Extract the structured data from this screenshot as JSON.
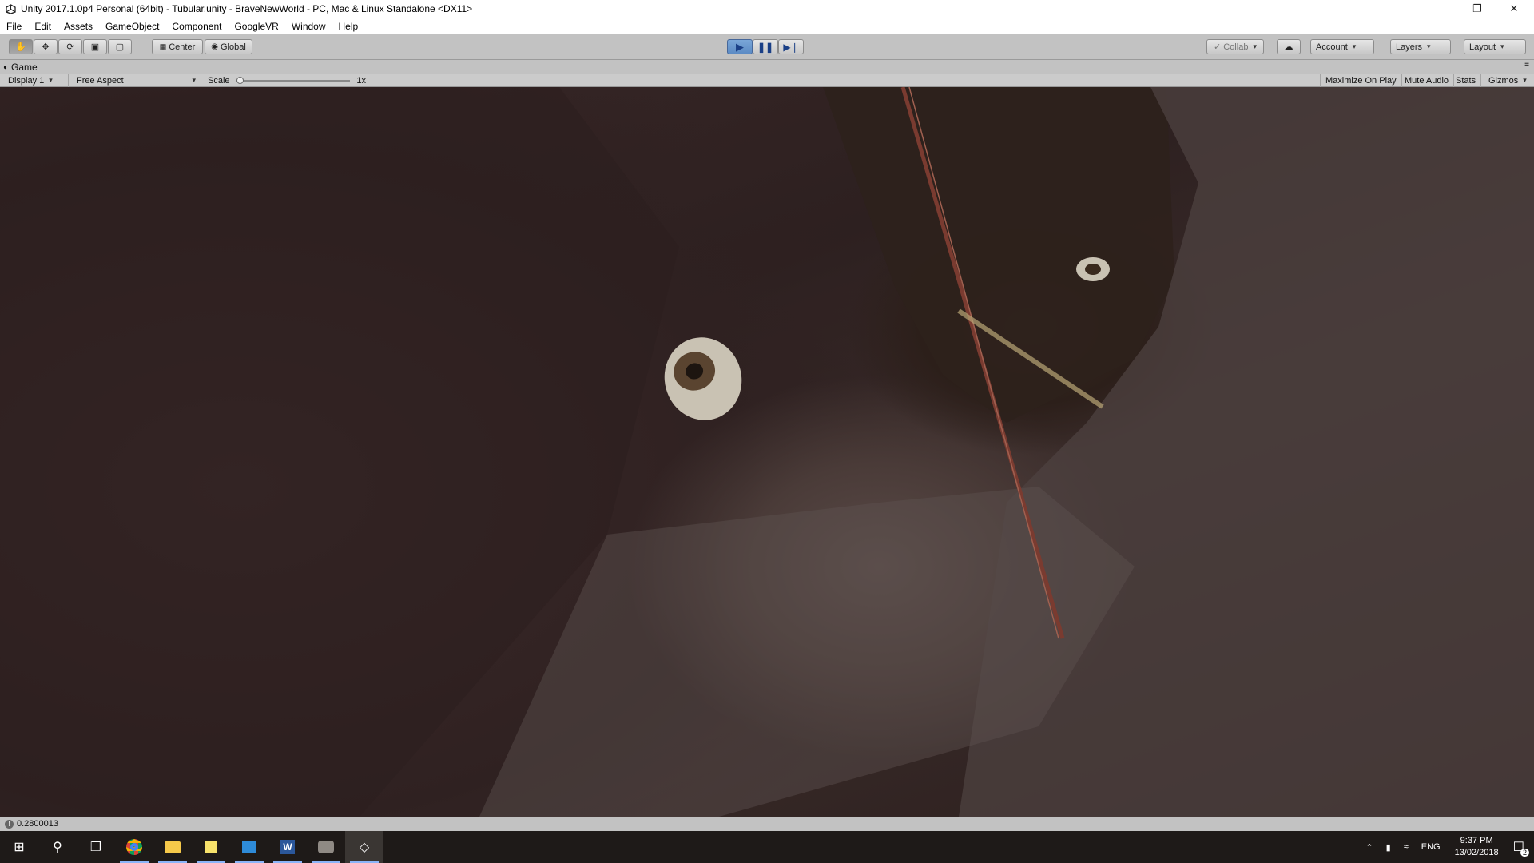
{
  "window": {
    "title": "Unity 2017.1.0p4 Personal (64bit) - Tubular.unity - BraveNewWorld - PC, Mac & Linux Standalone <DX11>",
    "minimize_icon": "minimize-icon",
    "maximize_icon": "restore-icon",
    "close_icon": "close-icon"
  },
  "menu": [
    "File",
    "Edit",
    "Assets",
    "GameObject",
    "Component",
    "GoogleVR",
    "Window",
    "Help"
  ],
  "toolbar": {
    "tools": [
      "hand-icon",
      "move-icon",
      "rotate-icon",
      "scale-icon",
      "rect-tool-icon"
    ],
    "pivot_label": "Center",
    "space_label": "Global",
    "playback": [
      "play-icon",
      "pause-icon",
      "step-icon"
    ],
    "collab_label": "Collab",
    "account_label": "Account",
    "layers_label": "Layers",
    "layout_label": "Layout"
  },
  "game_tab": {
    "label": "Game",
    "display": "Display 1",
    "aspect": "Free Aspect",
    "scale_label": "Scale",
    "scale_value": "1x",
    "maximize": "Maximize On Play",
    "mute": "Mute Audio",
    "stats": "Stats",
    "gizmos": "Gizmos"
  },
  "status": {
    "message": "0.2800013"
  },
  "taskbar": {
    "apps": [
      "windows-start-icon",
      "search-icon",
      "task-view-icon",
      "chrome-icon",
      "file-explorer-icon",
      "sticky-notes-icon",
      "outlook-icon",
      "word-icon",
      "gimp-icon",
      "unity-icon"
    ],
    "language": "ENG",
    "time": "9:37 PM",
    "date": "13/02/2018",
    "notification_count": "2"
  },
  "colors": {
    "play_active": "#5c8bc4",
    "toolbar_bg": "#c2c2c2",
    "taskbar_bg": "#1e1a18"
  }
}
